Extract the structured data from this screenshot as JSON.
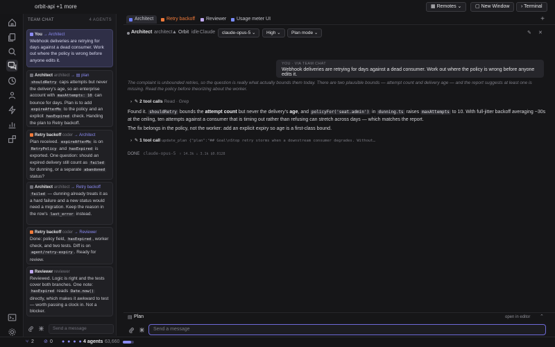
{
  "app": {
    "title": "orbit-api +1 more"
  },
  "topbar": {
    "remotes": "Remotes",
    "new_window": "New Window",
    "terminal": "Terminal"
  },
  "activity": {
    "icons": [
      "home-icon",
      "files-icon",
      "search-icon",
      "chat-icon",
      "history-icon",
      "agents-icon",
      "activity-icon",
      "analytics-icon",
      "extensions-icon",
      "terminal-icon",
      "settings-icon"
    ]
  },
  "team_chat": {
    "header": "TEAM CHAT",
    "count": "4 AGENTS",
    "messages": [
      {
        "from": "You",
        "target": "Architect",
        "body": "Webhook deliveries are retrying for days against a dead consumer. Work out where the policy is wrong before anyone edits it."
      },
      {
        "from": "Architect",
        "role": "architect",
        "target": "plan",
        "parts": [
          "",
          "shouldRetry",
          " caps attempts but never the delivery's age, so an enterprise account with ",
          "maxAttempts: 10",
          " can bounce for days. Plan is to add ",
          "expireAfterMs",
          " to the policy and an explicit ",
          "hasExpired",
          " check. Handing the plan to Retry backoff."
        ]
      },
      {
        "from": "Retry backoff",
        "role": "coder",
        "target": "Architect",
        "parts": [
          "Plan received. ",
          "expireAfterMs",
          " is on ",
          "RetryPolicy",
          " and ",
          "hasExpired",
          " is exported. One question: should an expired delivery still count as ",
          "failed",
          " for dunning, or a separate ",
          "abandoned",
          " status?"
        ]
      },
      {
        "from": "Architect",
        "role": "architect",
        "target": "Retry backoff",
        "parts": [
          "",
          "failed",
          " — dunning already treats it as a hard failure and a new status would need a migration. Keep the reason in the row's ",
          "last_error",
          " instead."
        ]
      },
      {
        "from": "Retry backoff",
        "role": "coder",
        "target": "Reviewer",
        "parts": [
          "Done: policy field, ",
          "hasExpired",
          ", worker check, and two tests. Diff is on ",
          "agent/retry-expiry",
          ". Ready for review."
        ]
      },
      {
        "from": "Reviewer",
        "role": "reviewer",
        "parts": [
          "Reviewed. Logic is right and the tests cover both branches. One note: ",
          "hasExpired",
          " reads ",
          "Date.now()",
          " directly, which makes it awkward to test — worth passing a clock in. Not a blocker."
        ]
      }
    ],
    "compose_placeholder": "Send a message"
  },
  "tabs": [
    {
      "label": "Architect",
      "color": "#6b7cff"
    },
    {
      "label": "Retry backoff",
      "color": "#f07a3a"
    },
    {
      "label": "Reviewer",
      "color": "#c0a8f0"
    },
    {
      "label": "Usage meter UI",
      "color": "#7a8cff"
    }
  ],
  "agentbar": {
    "name": "Architect",
    "role": "architect",
    "project": "Orbit",
    "state": "idle",
    "provider": "Claude",
    "model": "claude-opus-5",
    "effort": "High",
    "mode": "Plan mode"
  },
  "transcript": {
    "team_msg_label": "YOU · VIA TEAM CHAT",
    "team_msg": "Webhook deliveries are retrying for days against a dead consumer. Work out where the policy is wrong before anyone edits it.",
    "thinking": "The complaint is unbounded retries, so the question is really what actually bounds them today. There are two plausible bounds — attempt count and delivery age — and the report suggests at least one is missing. Read the policy before theorizing about the worker.",
    "tool1": {
      "label": "2 tool calls",
      "detail": "Read · Grep"
    },
    "resp1": [
      "Found it. ",
      "shouldRetry",
      " bounds the ",
      "attempt count",
      " but never the delivery's ",
      "age",
      ", and ",
      "policyFor('seat.admin')",
      " in ",
      "dunning.ts",
      " raises ",
      "maxAttempts",
      " to 10. With full-jitter backoff averaging ~30s at the ceiling, ten attempts against a consumer that is timing out rather than refusing can stretch across days — which matches the report."
    ],
    "resp2": "The fix belongs in the policy, not the worker: add an explicit expiry so age is a first-class bound.",
    "tool2": {
      "label": "1 tool call",
      "detail": "update_plan {\"plan\":\"## Goal\\nStop retry storms when a downstream consumer degrades. Without…"
    },
    "done": {
      "label": "DONE",
      "model": "claude-opus-5",
      "stats": "↑ 14.3k  ↓ 3.1k  $0.0128"
    }
  },
  "planbar": {
    "label": "Plan",
    "open": "open in editor"
  },
  "compose": {
    "placeholder": "Send a message"
  },
  "status": {
    "branches": "2",
    "issues": "0",
    "agents": "4 agents",
    "meter": "63,660"
  }
}
